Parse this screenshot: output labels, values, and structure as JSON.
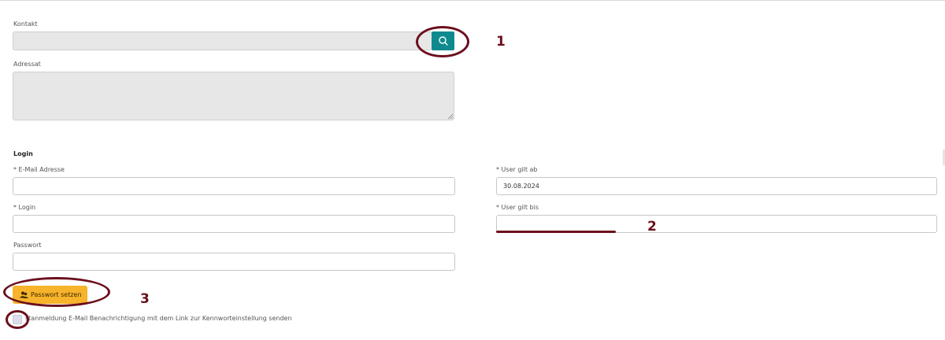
{
  "form": {
    "kontakt_label": "Kontakt",
    "adressat_label": "Adressat",
    "login_section": "Login",
    "email_label": "* E-Mail Adresse",
    "login_label": "* Login",
    "passwort_label": "Passwort",
    "user_gilt_ab_label": "* User gilt ab",
    "user_gilt_ab_value": "30.08.2024",
    "user_gilt_bis_label": "* User gilt bis",
    "passwort_button": "Passwort setzen",
    "checkbox_label": "stanmeldung E-Mail Benachrichtigung mit dem Link zur Kennworteinstellung senden"
  },
  "icons": {
    "search": "search-icon",
    "password_button": "users-icon"
  },
  "annotations": {
    "one": "1",
    "two": "2",
    "three": "3"
  },
  "colors": {
    "search_button": "#0e8a8f",
    "password_button": "#f7b32b",
    "annotation": "#6b0f1c",
    "disabled_field": "#e7e7e7"
  }
}
